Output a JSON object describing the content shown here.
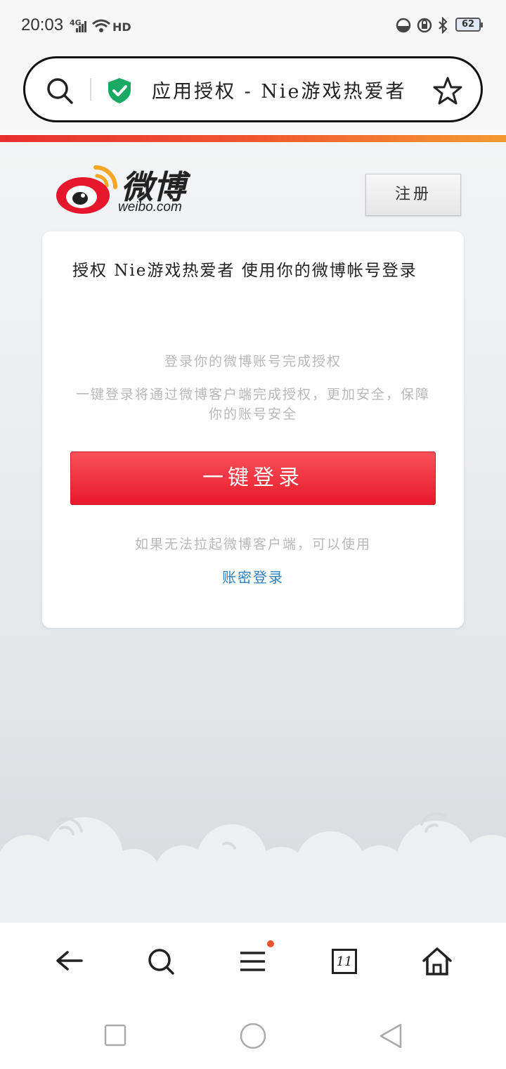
{
  "status_bar": {
    "time": "20:03",
    "network": "4G",
    "hd": "HD",
    "battery": "62"
  },
  "url_bar": {
    "title": "应用授权 - Nie游戏热爱者"
  },
  "header": {
    "logo_cn": "微博",
    "logo_en": "weibo.com",
    "register_label": "注册"
  },
  "card": {
    "title": "授权 Nie游戏热爱者 使用你的微博帐号登录",
    "hint_primary": "登录你的微博账号完成授权",
    "hint_secondary": "一键登录将通过微博客户端完成授权，更加安全，保障你的账号安全",
    "login_button": "一键登录",
    "fallback_text": "如果无法拉起微博客户端，可以使用",
    "password_login_link": "账密登录"
  },
  "bottom_nav": {
    "tab_count": "11"
  },
  "colors": {
    "accent_red": "#e8192a",
    "link_blue": "#2f7fbf",
    "shield_green": "#1aa863",
    "notification_dot": "#f2542d"
  },
  "icons": [
    "search-icon",
    "shield-check-icon",
    "star-icon",
    "back-arrow-icon",
    "menu-icon",
    "tabs-icon",
    "home-icon"
  ]
}
